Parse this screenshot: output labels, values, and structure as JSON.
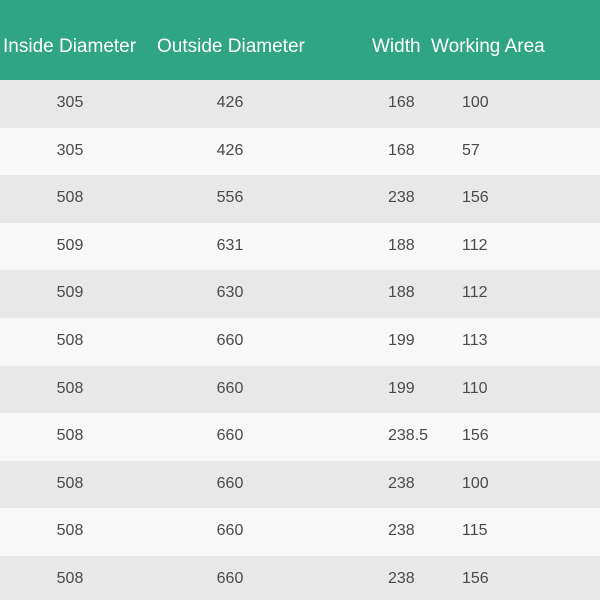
{
  "header": {
    "inside_diameter": "Inside Diameter",
    "outside_diameter": "Outside Diameter",
    "width": "Width",
    "working_area": "Working Area"
  },
  "rows": [
    [
      "305",
      "426",
      "168",
      "100"
    ],
    [
      "305",
      "426",
      "168",
      "57"
    ],
    [
      "508",
      "556",
      "238",
      "156"
    ],
    [
      "509",
      "631",
      "188",
      "112"
    ],
    [
      "509",
      "630",
      "188",
      "112"
    ],
    [
      "508",
      "660",
      "199",
      "113"
    ],
    [
      "508",
      "660",
      "199",
      "110"
    ],
    [
      "508",
      "660",
      "238.5",
      "156"
    ],
    [
      "508",
      "660",
      "238",
      "100"
    ],
    [
      "508",
      "660",
      "238",
      "115"
    ],
    [
      "508",
      "660",
      "238",
      "156"
    ]
  ],
  "colors": {
    "header_bg": "#2fa584",
    "header_text": "#ffffff",
    "row_odd": "#e8e8e8",
    "row_even": "#f8f8f8",
    "cell_text": "#4a4a4a"
  }
}
